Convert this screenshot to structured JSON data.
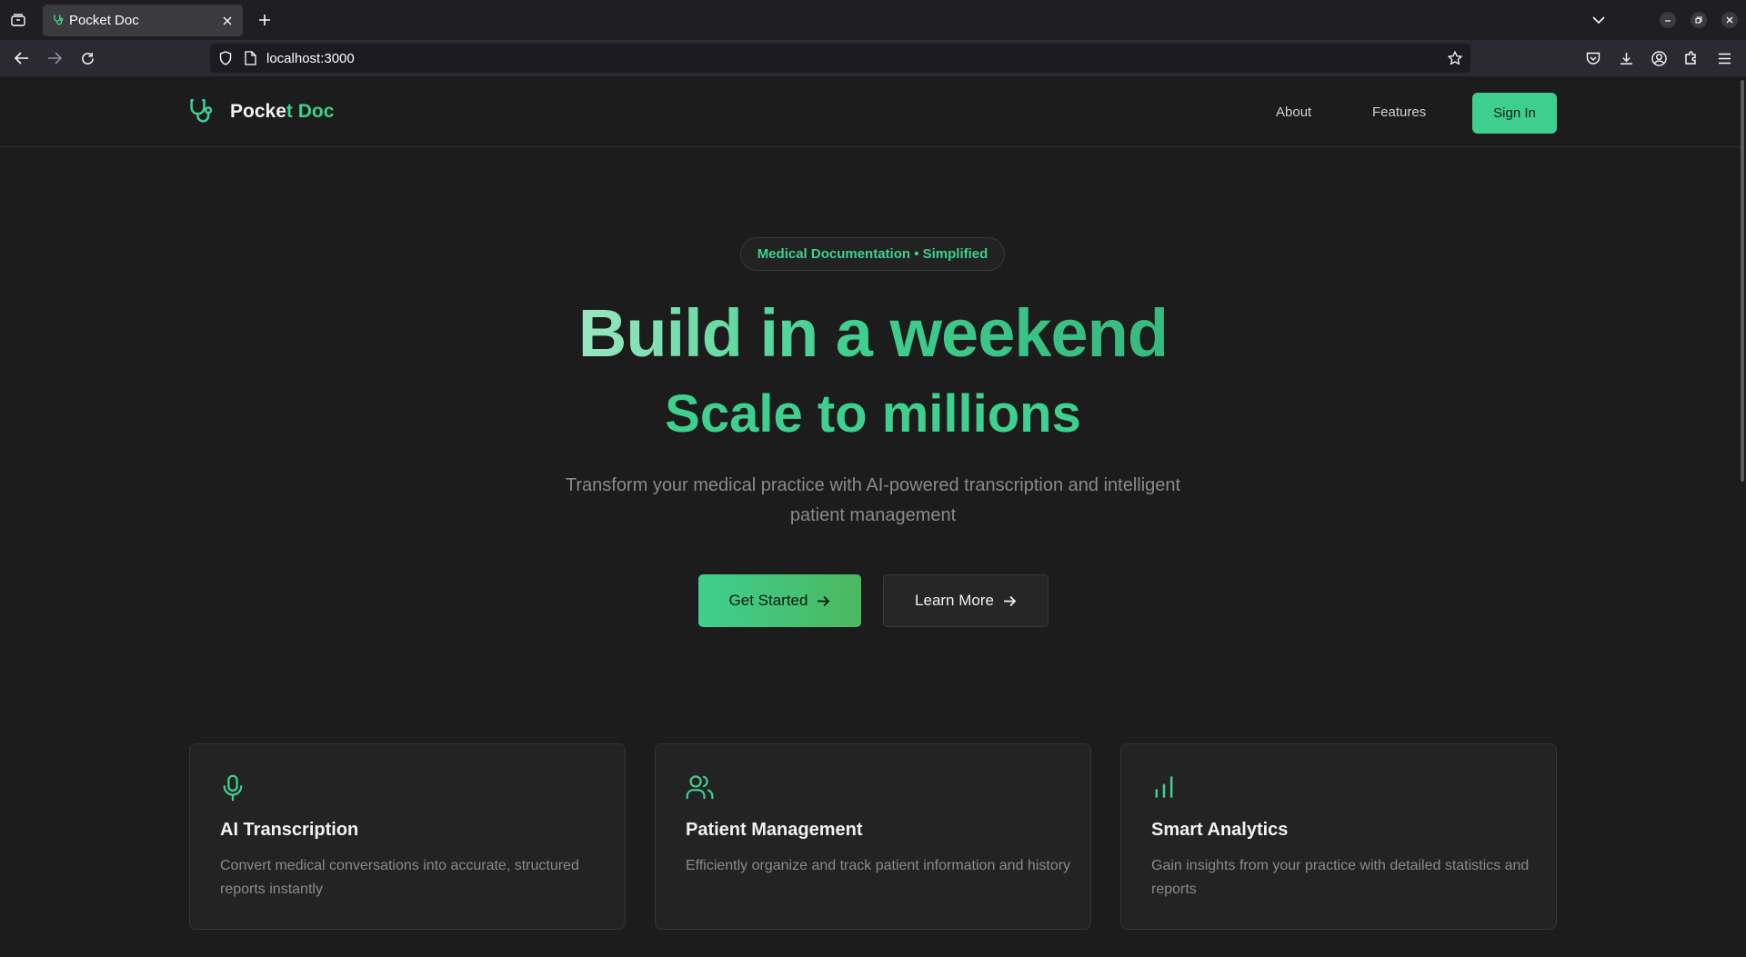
{
  "browser": {
    "tab_title": "Pocket Doc",
    "url": "localhost:3000"
  },
  "header": {
    "brand_first": "Pocke",
    "brand_second": "t Doc",
    "nav": {
      "about": "About",
      "features": "Features"
    },
    "signin_label": "Sign In"
  },
  "hero": {
    "badge": "Medical Documentation • Simplified",
    "headline": "Build in a weekend",
    "subheadline": "Scale to millions",
    "lead": "Transform your medical practice with AI-powered transcription and intelligent patient management",
    "primary_cta": "Get Started",
    "secondary_cta": "Learn More"
  },
  "features": [
    {
      "icon": "microphone-icon",
      "title": "AI Transcription",
      "description": "Convert medical conversations into accurate, structured reports instantly"
    },
    {
      "icon": "users-icon",
      "title": "Patient Management",
      "description": "Efficiently organize and track patient information and history"
    },
    {
      "icon": "bar-chart-icon",
      "title": "Smart Analytics",
      "description": "Gain insights from your practice with detailed statistics and reports"
    }
  ],
  "colors": {
    "accent": "#3fcf8e",
    "background": "#1c1c1c",
    "card": "#232323",
    "muted_text": "#8a8a8a"
  }
}
